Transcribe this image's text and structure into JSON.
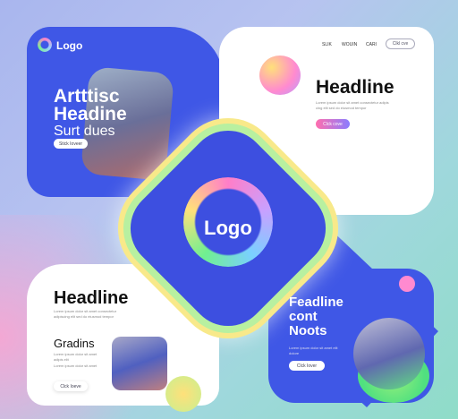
{
  "brand": {
    "logo_text": "Logo"
  },
  "nav": {
    "items": [
      "SLIK",
      "WOUIN",
      "CARI"
    ],
    "button": "Clkl cve"
  },
  "hero_left": {
    "title_line1": "Artttisc",
    "title_line2": "Headine",
    "subtitle": "Surt dues",
    "button": "Stick Ioveer"
  },
  "hero_right": {
    "title": "Headline",
    "body": "Lorem ipsum dolor sit amet consectetur adipis cing elit sed do eiusmod tempor",
    "button": "Clck cove"
  },
  "center": {
    "logo_text": "Logo"
  },
  "bottom_left": {
    "title": "Headline",
    "body": "Lorem ipsum dolor sit amet consectetur adipiscing elit sed do eiusmod tempor",
    "subtitle": "Gradins",
    "body2": "Lorem ipsum dolor sit amet adipis elit",
    "body3": "Lorem ipsum dolor sit amet",
    "button": "Clck Ioeve"
  },
  "bottom_right": {
    "title_line1": "Feadline",
    "title_line2": "cont",
    "title_line3": "Noots",
    "body": "Lorem ipsum dolor sit amet elit dolore",
    "button": "Clck Iover"
  },
  "colors": {
    "primary_blue": "#3f57e6",
    "pink": "#ff6fae",
    "green": "#7cf07a",
    "yellow": "#ffe37a"
  }
}
